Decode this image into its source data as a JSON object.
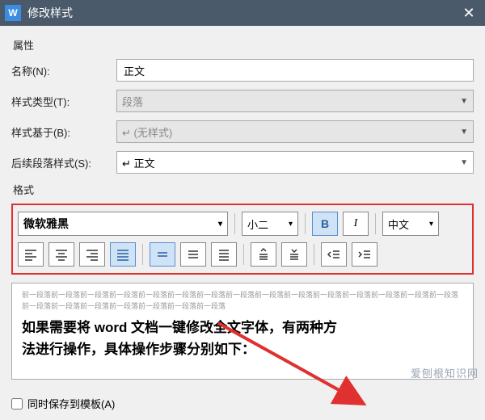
{
  "titlebar": {
    "logo": "W",
    "title": "修改样式"
  },
  "section_properties": "属性",
  "fields": {
    "name": {
      "label": "名称(N):",
      "value": "正文"
    },
    "styleType": {
      "label": "样式类型(T):",
      "value": "段落"
    },
    "basedOn": {
      "label": "样式基于(B):",
      "value": "↵  (无样式)"
    },
    "following": {
      "label": "后续段落样式(S):",
      "value": "↵ 正文"
    }
  },
  "section_format": "格式",
  "format": {
    "font": "微软雅黑",
    "size": "小二",
    "bold": "B",
    "italic": "I",
    "language": "中文"
  },
  "preview": {
    "gray": "前一段落前一段落前一段落前一段落前一段落前一段落前一段落前一段落前一段落前一段落前一段落前一段落前一段落前一段落前一段落前一段落前一段落前一段落前一段落前一段落前一段落前一段落",
    "sample_line1": "如果需要将 word 文档一键修改全文字体，有两种方",
    "sample_line2": "法进行操作，具体操作步骤分别如下："
  },
  "bottom": {
    "saveTemplate": "同时保存到模板(A)"
  },
  "watermark": "爱刨根知识网"
}
